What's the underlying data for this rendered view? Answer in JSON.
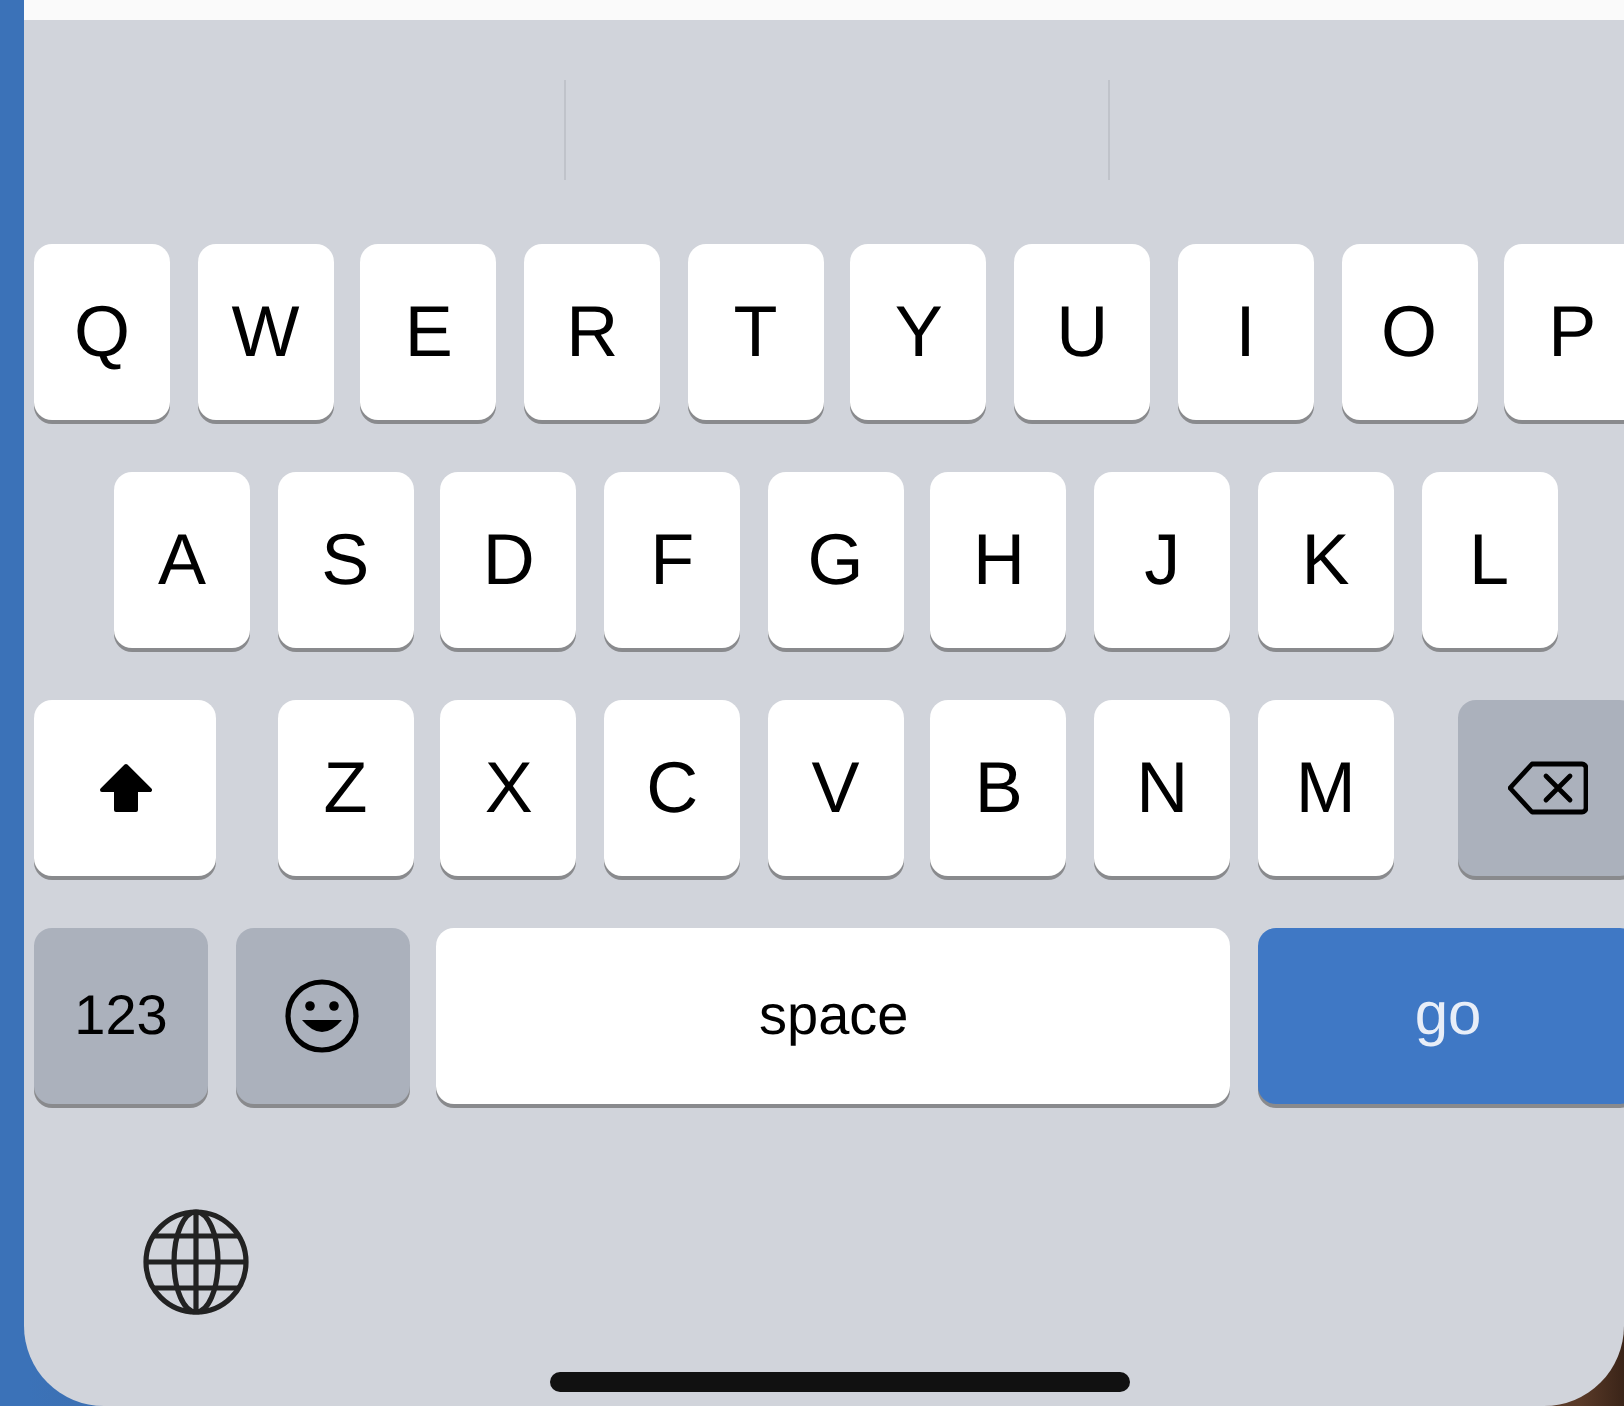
{
  "rows": [
    {
      "keys": [
        {
          "kind": "letter",
          "label": "Q"
        },
        {
          "kind": "letter",
          "label": "W"
        },
        {
          "kind": "letter",
          "label": "E"
        },
        {
          "kind": "letter",
          "label": "R"
        },
        {
          "kind": "letter",
          "label": "T"
        },
        {
          "kind": "letter",
          "label": "Y"
        },
        {
          "kind": "letter",
          "label": "U"
        },
        {
          "kind": "letter",
          "label": "I"
        },
        {
          "kind": "letter",
          "label": "O"
        },
        {
          "kind": "letter",
          "label": "P"
        }
      ]
    },
    {
      "keys": [
        {
          "kind": "letter",
          "label": "A"
        },
        {
          "kind": "letter",
          "label": "S"
        },
        {
          "kind": "letter",
          "label": "D"
        },
        {
          "kind": "letter",
          "label": "F"
        },
        {
          "kind": "letter",
          "label": "G"
        },
        {
          "kind": "letter",
          "label": "H"
        },
        {
          "kind": "letter",
          "label": "J"
        },
        {
          "kind": "letter",
          "label": "K"
        },
        {
          "kind": "letter",
          "label": "L"
        }
      ]
    },
    {
      "keys": [
        {
          "kind": "shift",
          "on": true
        },
        {
          "kind": "letter",
          "label": "Z"
        },
        {
          "kind": "letter",
          "label": "X"
        },
        {
          "kind": "letter",
          "label": "C"
        },
        {
          "kind": "letter",
          "label": "V"
        },
        {
          "kind": "letter",
          "label": "B"
        },
        {
          "kind": "letter",
          "label": "N"
        },
        {
          "kind": "letter",
          "label": "M"
        },
        {
          "kind": "delete"
        }
      ]
    },
    {
      "keys": [
        {
          "kind": "numbers",
          "label": "123"
        },
        {
          "kind": "emoji"
        },
        {
          "kind": "space",
          "label": "space"
        },
        {
          "kind": "go",
          "label": "go"
        }
      ]
    }
  ],
  "bottom": [
    {
      "kind": "globe"
    }
  ]
}
